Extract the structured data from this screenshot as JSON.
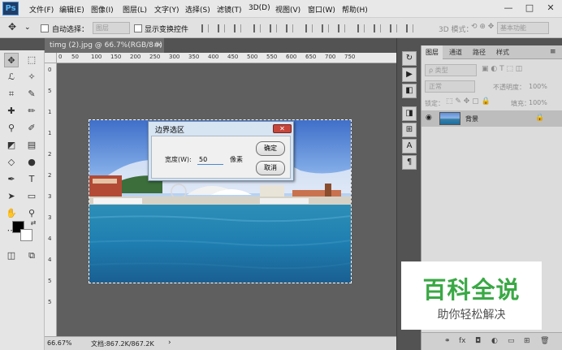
{
  "app": {
    "logo": "Ps"
  },
  "menu": [
    "文件(F)",
    "编辑(E)",
    "图像(I)",
    "图层(L)",
    "文字(Y)",
    "选择(S)",
    "滤镜(T)",
    "3D(D)",
    "视图(V)",
    "窗口(W)",
    "帮助(H)"
  ],
  "window": {
    "minimize": "—",
    "maximize": "□",
    "close": "✕"
  },
  "options": {
    "move_arrow": "⌄",
    "auto_select_label": "自动选择：",
    "auto_select_value": "图层",
    "transform_label": "显示变换控件",
    "mode_3d_label": "3D 模式：",
    "workspace": "基本功能"
  },
  "document": {
    "tab_title": "timg (2).jpg @ 66.7%(RGB/8#)",
    "tab_close": "×",
    "zoom": "66.67%",
    "doc_size": "文档:867.2K/867.2K",
    "status_arrow": "›"
  },
  "ruler": {
    "h_ticks": [
      "0",
      "50",
      "100",
      "150",
      "200",
      "250",
      "300",
      "350",
      "400",
      "450",
      "500",
      "550",
      "600",
      "650",
      "700",
      "750"
    ],
    "v_ticks": [
      "0",
      "5",
      "1",
      "1",
      "2",
      "2",
      "3",
      "3",
      "4",
      "4",
      "5",
      "5"
    ]
  },
  "dialog": {
    "title": "边界选区",
    "close": "✕",
    "width_label": "宽度(W):",
    "width_value": "50",
    "unit": "像素",
    "ok": "确定",
    "cancel": "取消"
  },
  "layers_panel": {
    "tabs": [
      "图层",
      "通道",
      "路径",
      "样式"
    ],
    "menu_icon": "≡",
    "collapse": "«",
    "kind_label": "ρ 类型",
    "blend_mode": "正常",
    "opacity_label": "不透明度：",
    "opacity_value": "100%",
    "lock_label": "锁定：",
    "fill_label": "填充：",
    "fill_value": "100%",
    "layer_name": "背景"
  },
  "watermark": {
    "title": "百科全说",
    "subtitle": "助你轻松解决"
  },
  "colors": {
    "accent": "#4a8ad4",
    "panel": "#dcdcdc",
    "workspace": "#535353"
  }
}
